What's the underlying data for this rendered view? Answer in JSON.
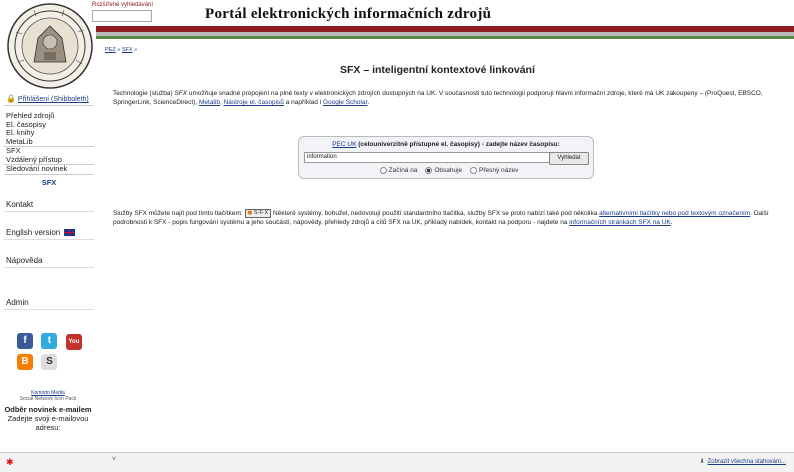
{
  "header": {
    "advanced_search_link": "Rozšířené vyhledávání",
    "portal_title": "Portál elektronických informačních zdrojů"
  },
  "breadcrumb": {
    "items": [
      "PEZ",
      "SFX"
    ],
    "separator": "»"
  },
  "sidebar": {
    "login_label": "Přihlášení (Shibboleth)",
    "nav_items": [
      "Přehled zdrojů",
      "El. časopisy",
      "El. knihy",
      "MetaLib",
      "SFX",
      "Vzdálený přístup",
      "Sledování novinek"
    ],
    "active_section": "SFX",
    "contact": "Kontakt",
    "english": "English version",
    "help": "Nápověda",
    "admin": "Admin",
    "social_icons": [
      "facebook-icon",
      "twitter-icon",
      "youtube-icon",
      "blogger-icon",
      "skype-icon"
    ],
    "credit_link": "Komodo Media",
    "credit_text": "Social Network Icon Pack",
    "subscribe_title": "Odběr novinek e-mailem",
    "subscribe_text": "Zadejte svoji e-mailovou adresu:"
  },
  "main": {
    "title": "SFX – inteligentní kontextové linkování",
    "intro": {
      "t1": "Technologie (služba) ",
      "em": "SFX",
      "t2": " umožňuje snadné propojení na plné texty v elektronických zdrojích dostupných na UK. V současnosti tuto technologii podporují hlavní informační zdroje, které má UK zakoupeny – (ProQuest, EBSCO, SpringerLink, ScienceDirect), ",
      "link1": "Metalib",
      "t3": ", ",
      "link2": "Nástroje el. časopisů",
      "t4": " a například i ",
      "link3": "Google Scholar",
      "t5": "."
    },
    "search": {
      "label_link": "PEC UK",
      "label_text": " (celouniverzitně přístupné el. časopisy) - zadejte název časopisu:",
      "input_value": "information",
      "button": "Vyhledat",
      "options": [
        "Začíná na",
        "Obsahuje",
        "Přesný název"
      ],
      "selected": "Obsahuje"
    },
    "sfx_info": {
      "t1": "Služby SFX můžete najít pod tímto tlačítkem: ",
      "btn": "S·F·X",
      "t2": " Některé systémy, bohužel, nedovolují použití standardního tlačítka, služby SFX se proto nabízí také pod několika ",
      "link1": "alternativními tlačítky nebo pod textovým označením",
      "t3": ". Další podrobnosti k SFX - popis fungování systému a jeho součástí, nápovědy, přehledy zdrojů a cílů SFX na UK, příklady nabídek, kontakt na podporu - najdete na ",
      "link2": "informačních stránkách SFX na UK",
      "t4": "."
    }
  },
  "bottom_bar": {
    "show_downloads": "Zobrazit všechna stahování..."
  },
  "colors": {
    "brand_red": "#8e1b23",
    "link": "#1a3a8a"
  }
}
